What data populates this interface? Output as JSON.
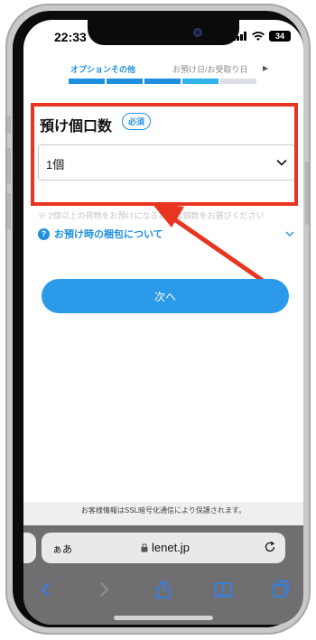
{
  "status": {
    "time": "22:33",
    "battery": "34"
  },
  "steps": {
    "active_label": "オプションその他",
    "next_label": "お預け日/お受取り日"
  },
  "field": {
    "title": "預け個口数",
    "required_badge": "必須",
    "selected_value": "1個"
  },
  "hint_text": "※ 2個以上の荷物をお預けになる場合は個数をお選びください",
  "info": {
    "icon_text": "?",
    "label": "お預け時の梱包について"
  },
  "next_button": "次へ",
  "ssl_notice": "お客様情報はSSL暗号化通信により保護されます。",
  "browser": {
    "text_size_label": "ぁあ",
    "url": "lenet.jp"
  },
  "colors": {
    "accent": "#1f8fe0",
    "highlight": "#e8351f",
    "button": "#2b9ae8"
  },
  "progress_segments": [
    "#1f8fe0",
    "#1f8fe0",
    "#1f8fe0",
    "#30b3ea",
    "#dcdfe4"
  ]
}
